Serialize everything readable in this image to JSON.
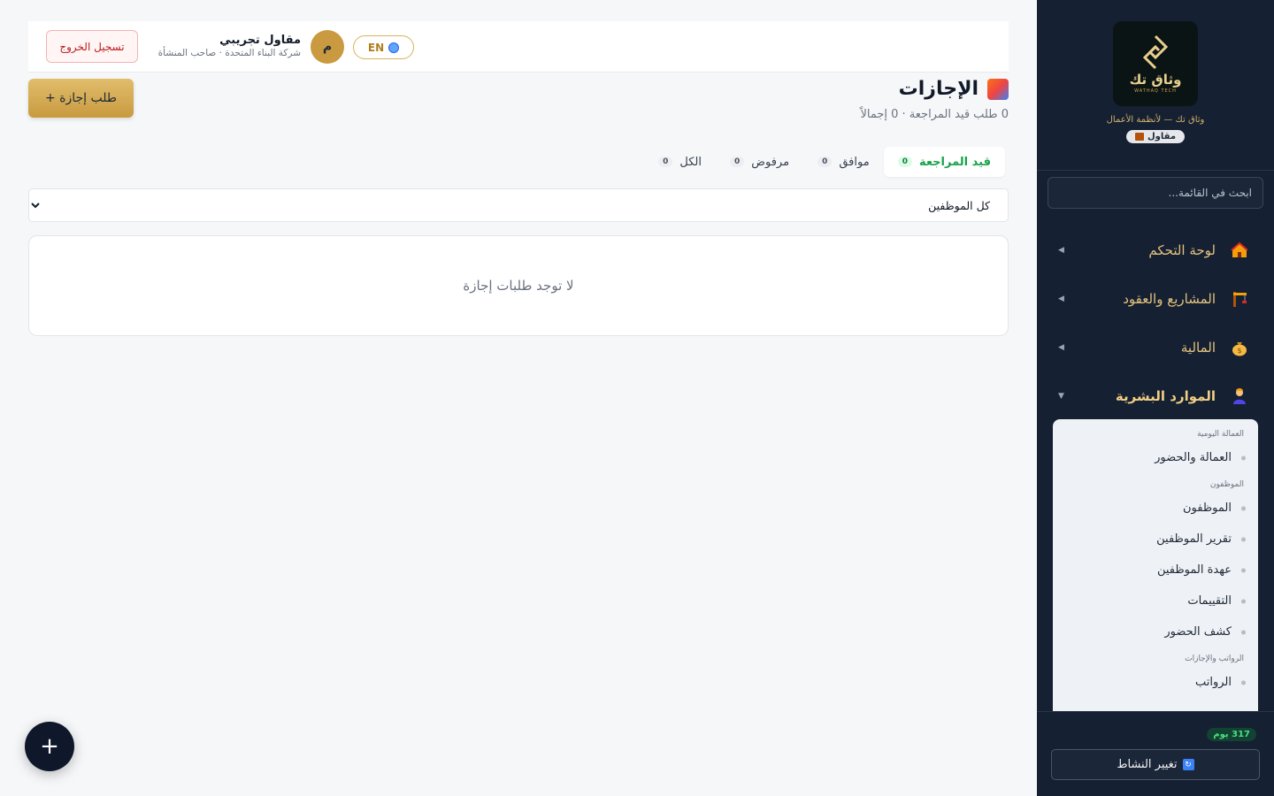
{
  "sidebar": {
    "logo_word": "وثاق تك",
    "logo_sub": "WATHAQ TECH",
    "tagline": "وثاق تك — لأنظمة الأعمال",
    "role_badge": "مقاول",
    "search_placeholder": "ابحث في القائمة...",
    "nav": [
      {
        "label": "لوحة التحكم",
        "icon": "home-icon"
      },
      {
        "label": "المشاريع والعقود",
        "icon": "crane-icon"
      },
      {
        "label": "المالية",
        "icon": "money-bag-icon"
      },
      {
        "label": "الموارد البشرية",
        "icon": "worker-icon",
        "expanded": true
      }
    ],
    "submenu": {
      "groups": [
        "العمالة اليومية",
        "الموظفون",
        "الرواتب والإجازات"
      ],
      "items": [
        "العمالة والحضور",
        "الموظفون",
        "تقرير الموظفين",
        "عهدة الموظفين",
        "التقييمات",
        "كشف الحضور",
        "الرواتب"
      ]
    },
    "days_badge": "317 يوم",
    "switch_button": "تغيير النشاط"
  },
  "topbar": {
    "logout": "تسجيل الخروج",
    "user_name": "مقاول تجريبي",
    "user_sub": "شركة البناء المتحدة · صاحب المنشأة",
    "avatar_letter": "م",
    "lang": "EN"
  },
  "page": {
    "title": "الإجازات",
    "subtitle": "0 طلب قيد المراجعة · 0 إجمالاً",
    "new_button": "+ طلب إجازة",
    "tabs": [
      {
        "label": "قيد المراجعة",
        "count": "0",
        "active": true
      },
      {
        "label": "موافق",
        "count": "0"
      },
      {
        "label": "مرفوض",
        "count": "0"
      },
      {
        "label": "الكل",
        "count": "0"
      }
    ],
    "filter_selected": "كل الموظفين",
    "empty_message": "لا توجد طلبات إجازة",
    "fab": "+"
  },
  "colors": {
    "sidebar_bg": "#152032",
    "gold": "#c99a3f",
    "active_tab": "#16a34a",
    "logout": "#b91c1c"
  }
}
